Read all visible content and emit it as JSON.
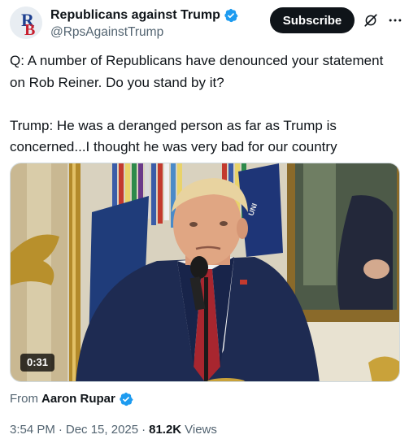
{
  "author": {
    "avatar_text": "RB",
    "display_name": "Republicans against Trump",
    "handle": "@RpsAgainstTrump",
    "verified_icon": "verified-badge-icon"
  },
  "actions": {
    "subscribe_label": "Subscribe",
    "grok_icon": "grok-icon",
    "more_icon": "more-icon"
  },
  "tweet": {
    "text": "Q: A number of Republicans have denounced your statement on Rob Reiner. Do you stand by it?\n\nTrump: He was a deranged person as far as Trump is concerned...I thought he was very bad for our country"
  },
  "media": {
    "type": "video",
    "duration": "0:31",
    "flag_text": "UNI"
  },
  "attribution": {
    "prefix": "From",
    "name": "Aaron Rupar"
  },
  "meta": {
    "time": "3:54 PM",
    "date": "Dec 15, 2025",
    "separator": "·",
    "views_count": "81.2K",
    "views_label": "Views"
  },
  "colors": {
    "text": "#0f1419",
    "secondary": "#536471",
    "verified": "#1d9bf0",
    "subscribe_bg": "#0f1419"
  }
}
